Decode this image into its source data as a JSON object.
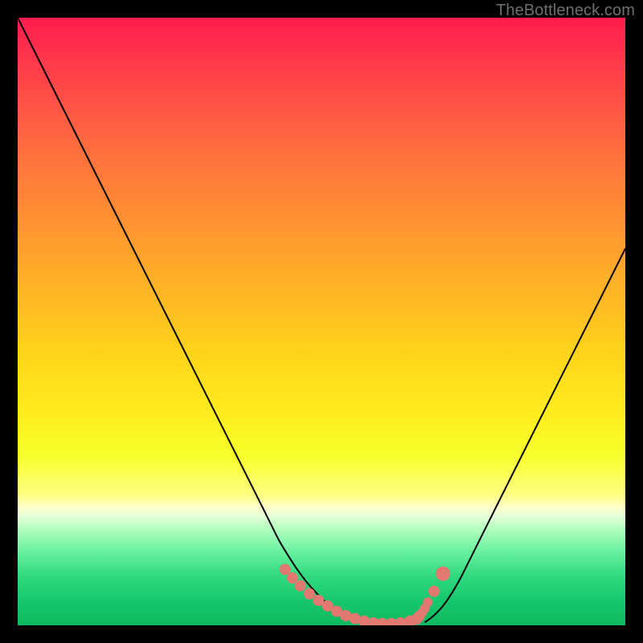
{
  "watermark": "TheBottleneck.com",
  "colors": {
    "frame": "#000000",
    "curve": "#000000",
    "dots": "#e2786f"
  },
  "chart_data": {
    "type": "line",
    "title": "",
    "xlabel": "",
    "ylabel": "",
    "xlim": [
      0,
      100
    ],
    "ylim": [
      0,
      100
    ],
    "grid": false,
    "legend": false,
    "series": [
      {
        "name": "left-curve",
        "x": [
          0,
          2,
          4,
          6,
          8,
          10,
          12,
          14,
          18,
          22,
          26,
          30,
          34,
          38,
          41,
          43,
          44.5,
          46,
          47.5,
          49,
          50.5,
          52,
          53.5,
          55,
          56.5,
          58,
          59
        ],
        "y": [
          100,
          96,
          92,
          88,
          84,
          80,
          76,
          72,
          64,
          56,
          48,
          40,
          32,
          24,
          18,
          14,
          11.5,
          9.2,
          7.2,
          5.5,
          4,
          2.8,
          1.9,
          1.2,
          0.7,
          0.3,
          0.2
        ]
      },
      {
        "name": "right-curve",
        "x": [
          100,
          98,
          96,
          94,
          92,
          90,
          88,
          86,
          84,
          82,
          80,
          78,
          76,
          74,
          73,
          72,
          71,
          70,
          69,
          68,
          67
        ],
        "y": [
          62,
          58,
          54,
          50,
          46,
          42,
          38,
          34,
          30,
          26,
          22,
          18,
          14,
          10,
          8,
          6.2,
          4.6,
          3.2,
          2.1,
          1.2,
          0.5
        ]
      }
    ],
    "scatter_series": [
      {
        "name": "bottom-dots",
        "x": [
          44,
          45.2,
          46.5,
          48,
          49.5,
          51,
          52.5,
          54,
          55.5,
          57,
          58.5,
          60,
          61.5,
          63,
          64.6,
          65.6,
          66,
          66.5,
          67,
          67.5,
          68.5,
          70
        ],
        "y": [
          9.2,
          7.8,
          6.5,
          5.2,
          4.1,
          3.2,
          2.3,
          1.6,
          1.1,
          0.7,
          0.4,
          0.3,
          0.3,
          0.4,
          0.7,
          1.0,
          1.4,
          2.0,
          2.8,
          3.8,
          5.6,
          8.5
        ],
        "r": [
          7,
          7,
          7,
          7,
          7,
          7,
          7,
          7,
          7,
          7,
          7,
          7,
          7,
          7,
          7,
          7,
          7,
          6,
          6,
          6,
          7,
          9
        ]
      }
    ]
  }
}
